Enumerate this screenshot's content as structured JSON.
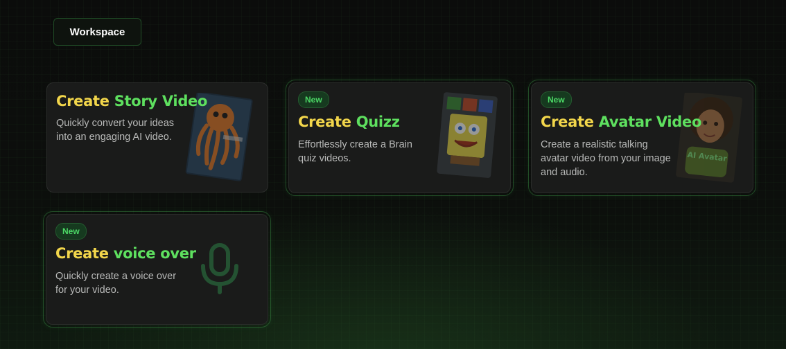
{
  "workspace_button": "Workspace",
  "cards": [
    {
      "title_1": "Create",
      "title_2": "Story Video",
      "description_line_1": "Quickly convert your ideas",
      "description_line_2": "into an engaging AI video.",
      "thumbnail": "octopus-storybook-image"
    },
    {
      "badge": "New",
      "title_1": "Create",
      "title_2": "Quizz",
      "description_line_1": "Effortlessly create a Brain",
      "description_line_2": "quiz videos.",
      "thumbnail": "spongebob-quiz-image"
    },
    {
      "badge": "New",
      "title_1": "Create",
      "title_2": "Avatar Video",
      "description_line_1": "Create a realistic talking",
      "description_line_2": "avatar video from your image",
      "description_line_3": "and audio.",
      "thumbnail": "ai-avatar-image",
      "thumbnail_text": "AI Avatar"
    },
    {
      "badge": "New",
      "title_1": "Create",
      "title_2": "voice over",
      "description_line_1": "Quickly create a voice over",
      "description_line_2": "for your video.",
      "thumbnail": "microphone-icon"
    }
  ],
  "colors": {
    "title_yellow": "#f2d64b",
    "title_green": "#5ee05f",
    "badge_green": "#4cd866",
    "card_bg": "#1a1b1a"
  }
}
